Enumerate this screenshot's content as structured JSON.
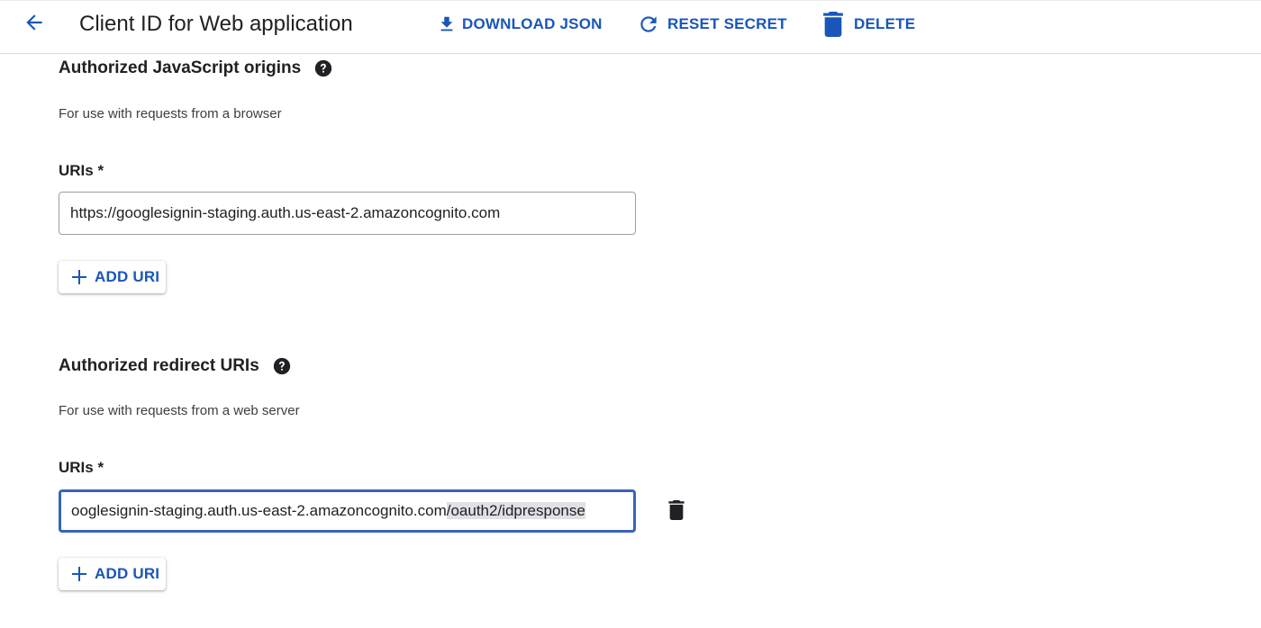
{
  "header": {
    "title": "Client ID for Web application",
    "download_json_label": "DOWNLOAD JSON",
    "reset_secret_label": "RESET SECRET",
    "delete_label": "DELETE",
    "back_icon": "arrow-left-icon"
  },
  "js_origins": {
    "title": "Authorized JavaScript origins",
    "description": "For use with requests from a browser",
    "uris_label": "URIs *",
    "uri_value": "https://googlesignin-staging.auth.us-east-2.amazoncognito.com",
    "add_uri_label": "ADD URI"
  },
  "redirect_uris": {
    "title": "Authorized redirect URIs",
    "description": "For use with requests from a web server",
    "uris_label": "URIs *",
    "uri_value_visible_prefix": "ooglesignin-staging.auth.us-east-2.amazoncognito.com",
    "uri_value_selected": "/oauth2/idpresponse",
    "add_uri_label": "ADD URI"
  },
  "colors": {
    "accent": "#1a56b9",
    "focus_border": "#3a63b8",
    "text": "#202124"
  }
}
